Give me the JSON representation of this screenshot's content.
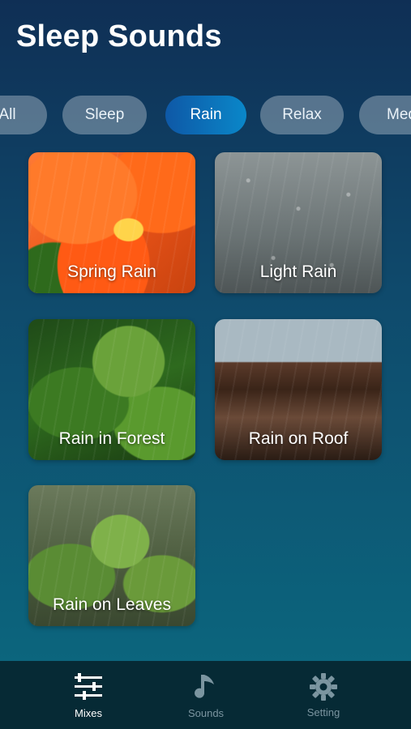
{
  "header": {
    "title": "Sleep Sounds"
  },
  "filters": {
    "items": [
      {
        "label": "All"
      },
      {
        "label": "Sleep"
      },
      {
        "label": "Rain"
      },
      {
        "label": "Relax"
      },
      {
        "label": "Med"
      }
    ],
    "selected": "Rain"
  },
  "cards": [
    {
      "label": "Spring Rain",
      "icon": "spring-rain-image"
    },
    {
      "label": "Light Rain",
      "icon": "light-rain-image"
    },
    {
      "label": "Rain in Forest",
      "icon": "rain-forest-image"
    },
    {
      "label": "Rain on Roof",
      "icon": "rain-roof-image"
    },
    {
      "label": "Rain on Leaves",
      "icon": "rain-leaves-image"
    }
  ],
  "nav": {
    "items": [
      {
        "label": "Mixes",
        "icon": "sliders-icon",
        "active": true
      },
      {
        "label": "Sounds",
        "icon": "music-note-icon",
        "active": false
      },
      {
        "label": "Setting",
        "icon": "gear-icon",
        "active": false
      }
    ]
  },
  "colors": {
    "active_chip": "#0e6fb8",
    "nav_bg": "#062a35",
    "background_top": "#0f2f55",
    "background_bottom": "#0b6a80"
  }
}
